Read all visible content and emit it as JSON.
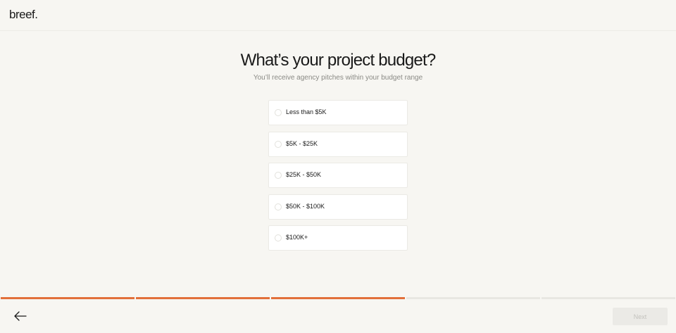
{
  "header": {
    "logo": "breef."
  },
  "question": {
    "title": "What’s your project budget?",
    "subtitle": "You’ll receive agency pitches within your budget range"
  },
  "options": [
    {
      "label": "Less than $5K",
      "selected": false
    },
    {
      "label": "$5K - $25K",
      "selected": false
    },
    {
      "label": "$25K - $50K",
      "selected": false
    },
    {
      "label": "$50K - $100K",
      "selected": false
    },
    {
      "label": "$100K+",
      "selected": false
    }
  ],
  "progress": {
    "total_steps": 5,
    "completed_steps": 3
  },
  "footer": {
    "next_label": "Next",
    "back_icon": "arrow-left-icon"
  },
  "colors": {
    "accent": "#e2703a",
    "background": "#f7f6f2",
    "track": "#e8e7e2"
  }
}
